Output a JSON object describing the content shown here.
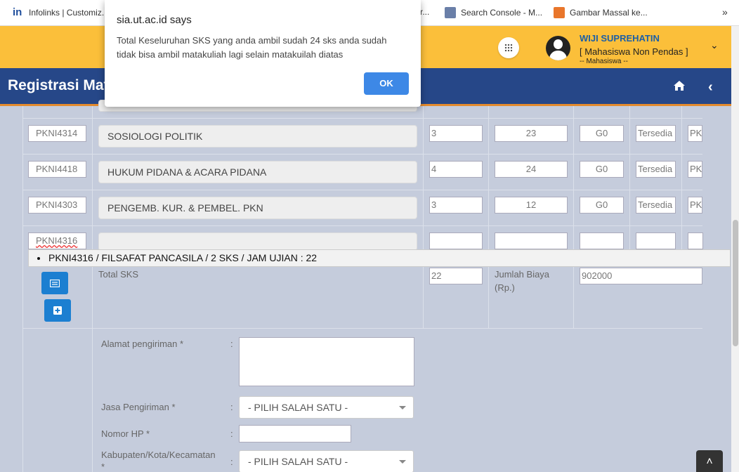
{
  "bookmarks": {
    "items": [
      {
        "label": "Infolinks | Customiz...",
        "icon": "infolinks-icon"
      },
      {
        "label": "r...",
        "icon": ""
      },
      {
        "label": "Search Console - M...",
        "icon": "search-console-icon"
      },
      {
        "label": "Gambar Massal ke...",
        "icon": "bookmark-icon"
      }
    ],
    "more": "»"
  },
  "header": {
    "user_name": "WIJI SUPREHATIN",
    "user_role": "[ Mahasiswa Non Pendas ]",
    "user_sub": "-- Mahasiswa --",
    "accent": "#fbbf3a"
  },
  "titlebar": {
    "title": "Registrasi Mata",
    "color": "#264788"
  },
  "courses": [
    {
      "code": "PKNI4314",
      "name": "SOSIOLOGI POLITIK",
      "sks": "3",
      "jam": "23",
      "g": "G0",
      "status": "Tersedia",
      "extra": "PKI"
    },
    {
      "code": "PKNI4418",
      "name": "HUKUM PIDANA & ACARA PIDANA",
      "sks": "4",
      "jam": "24",
      "g": "G0",
      "status": "Tersedia",
      "extra": "PKI"
    },
    {
      "code": "PKNI4303",
      "name": "PENGEMB. KUR. & PEMBEL. PKN",
      "sks": "3",
      "jam": "12",
      "g": "G0",
      "status": "Tersedia",
      "extra": "PKI"
    },
    {
      "code": "PKNI4316",
      "name": "",
      "sks": "",
      "jam": "",
      "g": "",
      "status": "",
      "extra": ""
    }
  ],
  "autocomplete": "PKNI4316 / FILSAFAT PANCASILA / 2 SKS / JAM UJIAN : 22",
  "totals": {
    "total_sks_label": "Total SKS",
    "total_sks_value": "22",
    "biaya_label_1": "Jumlah Biaya",
    "biaya_label_2": "(Rp.)",
    "biaya_value": "902000"
  },
  "form": {
    "alamat_label": "Alamat pengiriman *",
    "jasa_label": "Jasa Pengiriman *",
    "jasa_value": "- PILIH SALAH SATU -",
    "hp_label": "Nomor HP *",
    "kab_label_1": "Kabupaten/Kota/Kecamatan",
    "kab_label_2": "*",
    "kab_value": "- PILIH SALAH SATU -",
    "colon": ":"
  },
  "dialog": {
    "title": "sia.ut.ac.id says",
    "message": "Total Keseluruhan SKS yang anda ambil sudah 24 sks anda sudah tidak bisa ambil matakuliah lagi selain matakuilah diatas",
    "ok": "OK"
  }
}
